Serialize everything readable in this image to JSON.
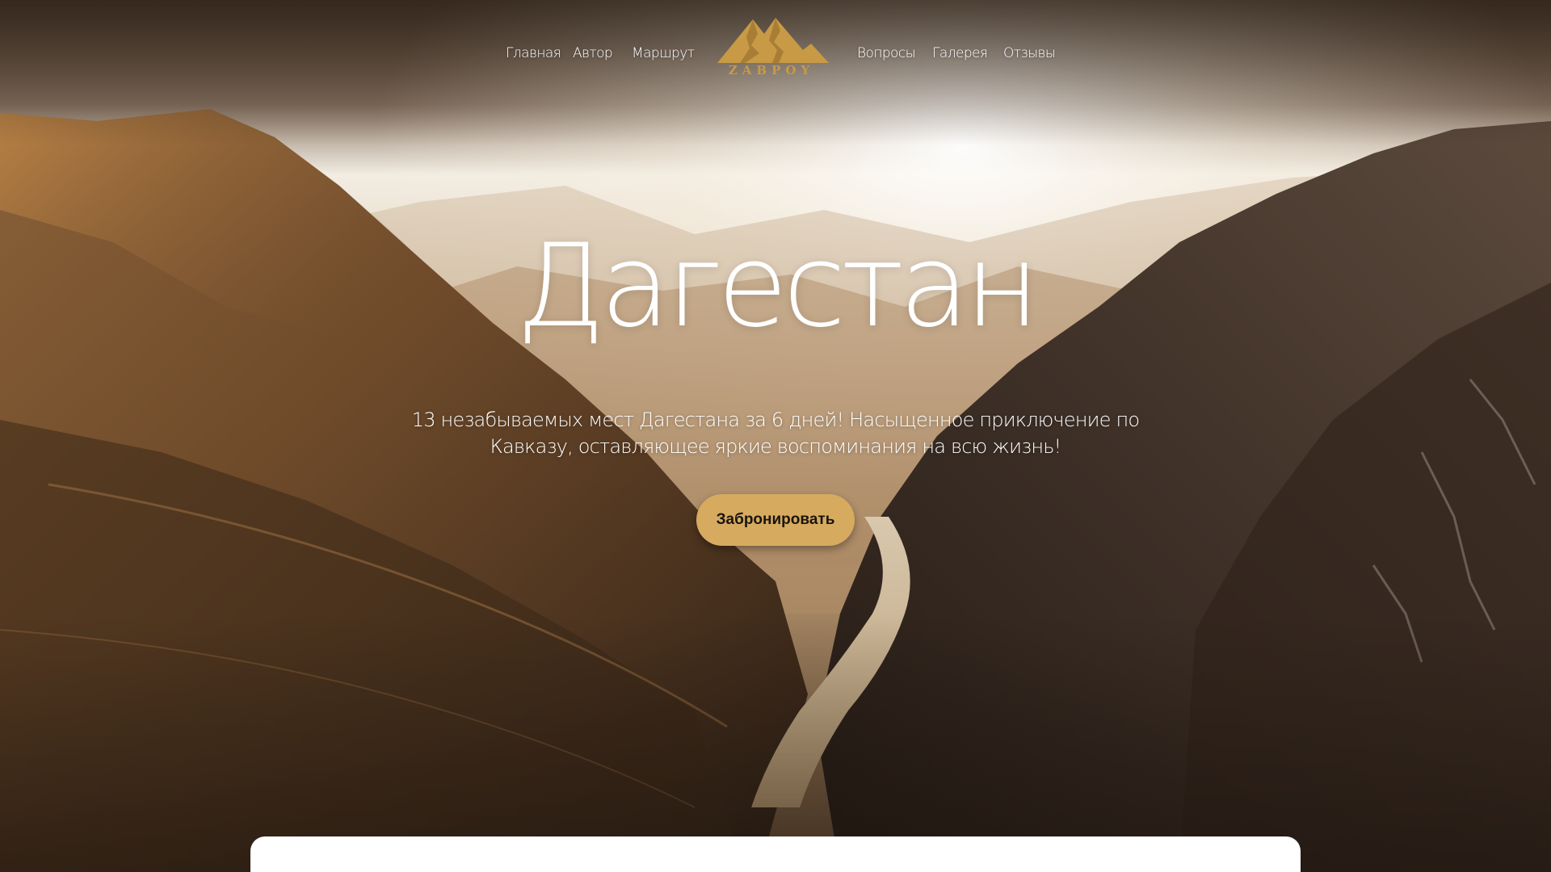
{
  "nav": {
    "left_items": [
      {
        "label": "Главная"
      },
      {
        "label": "Автор"
      },
      {
        "label": "Маршрут"
      }
    ],
    "right_items": [
      {
        "label": "Вопросы"
      },
      {
        "label": "Галерея"
      },
      {
        "label": "Отзывы"
      }
    ],
    "logo": {
      "wordmark": "ZABPOY",
      "icon": "mountain-logo-icon"
    }
  },
  "hero": {
    "title": "Дагестан",
    "subtitle_line1": "13 незабываемых мест Дагестана за 6 дней! Насыщенное приключение по",
    "subtitle_line2": "Кавказу, оставляющее яркие воспоминания на всю жизнь!",
    "cta_label": "Забронировать"
  },
  "colors": {
    "accent": "#d6ab60",
    "logo_gold": "#c89a45",
    "text_light": "#ffffff"
  }
}
